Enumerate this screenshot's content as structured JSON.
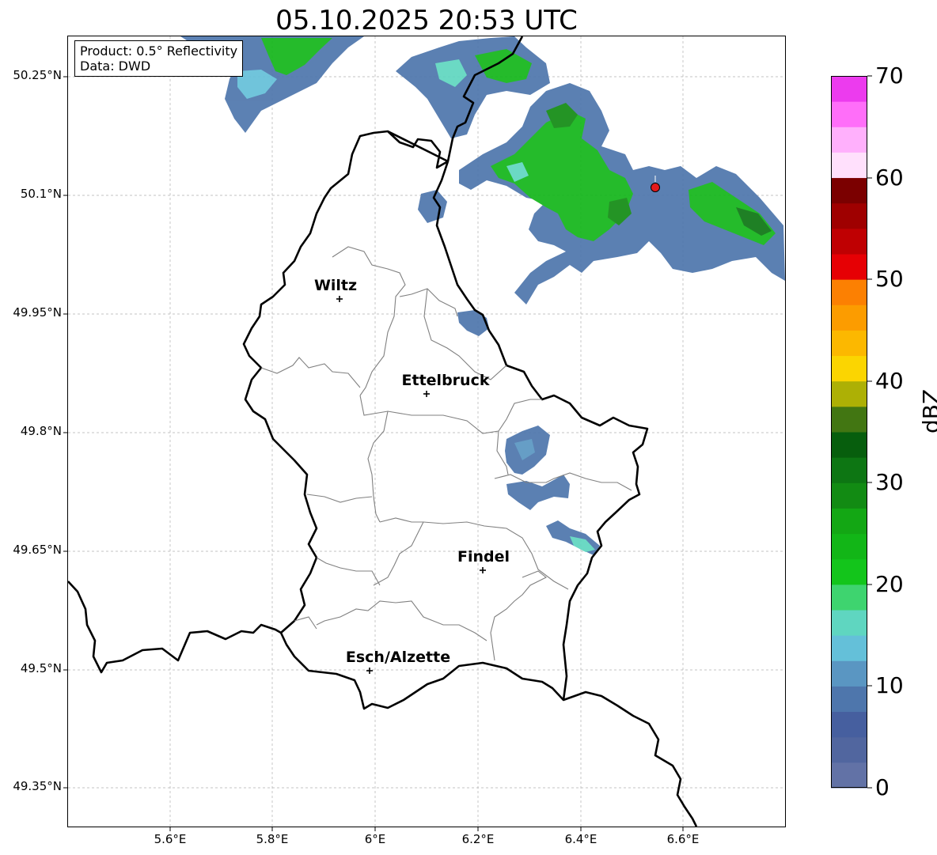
{
  "title": "05.10.2025 20:53 UTC",
  "info": {
    "product": "Product: 0.5° Reflectivity",
    "source": "Data: DWD"
  },
  "lat_labels": [
    "50.25°N",
    "50.1°N",
    "49.95°N",
    "49.8°N",
    "49.65°N",
    "49.5°N",
    "49.35°N"
  ],
  "lon_labels": [
    "5.6°E",
    "5.8°E",
    "6°E",
    "6.2°E",
    "6.4°E",
    "6.6°E"
  ],
  "cities": [
    "Wiltz",
    "Ettelbruck",
    "Findel",
    "Esch/Alzette"
  ],
  "radar_site_marker_color": "#e31a1c",
  "colorbar": {
    "label": "dBZ",
    "ticks": [
      "0",
      "10",
      "20",
      "30",
      "40",
      "50",
      "60",
      "70"
    ],
    "colors": [
      "#6272a6",
      "#51669f",
      "#465f9f",
      "#4e76ac",
      "#5a96c2",
      "#64c0d9",
      "#5fd6c0",
      "#3ed46f",
      "#13c51b",
      "#12b617",
      "#13a714",
      "#128b13",
      "#0d7613",
      "#075e0d",
      "#427612",
      "#adb005",
      "#fbd501",
      "#fcb800",
      "#fc9c00",
      "#fc8002",
      "#e60004",
      "#bf0002",
      "#9f0000",
      "#7b0000",
      "#ffe0fc",
      "#ffb0fc",
      "#ff6ef9",
      "#ec3bee"
    ]
  }
}
